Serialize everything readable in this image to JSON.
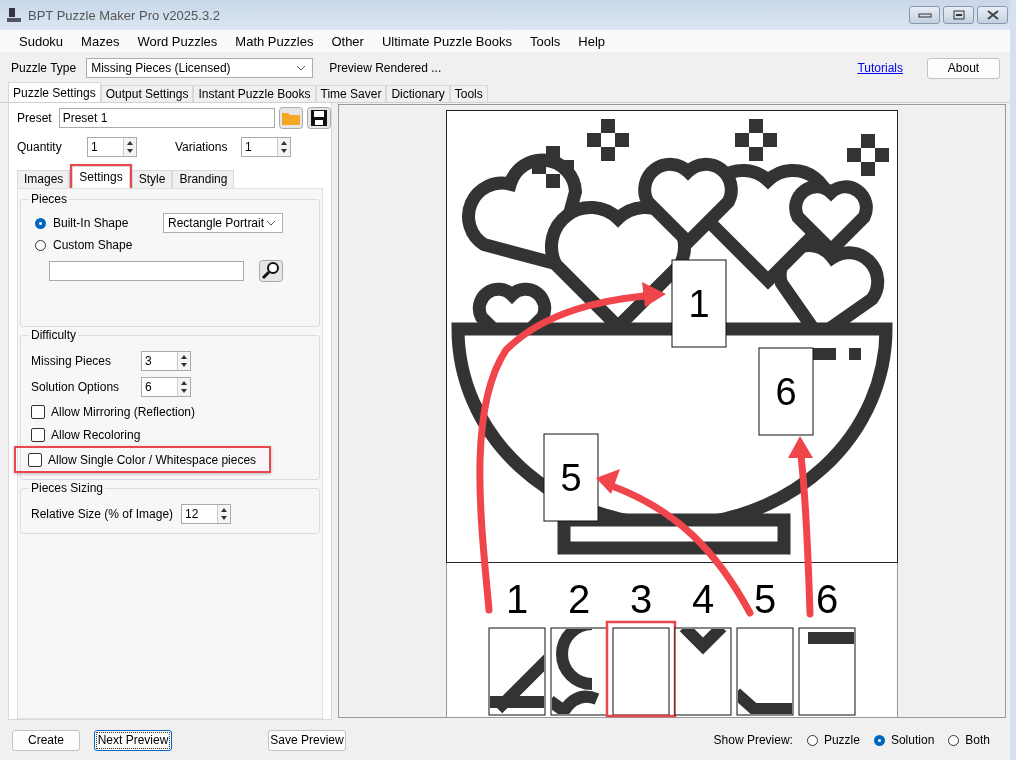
{
  "window": {
    "title": "BPT Puzzle Maker Pro v2025.3.2"
  },
  "menu": [
    "Sudoku",
    "Mazes",
    "Word Puzzles",
    "Math Puzzles",
    "Other",
    "Ultimate Puzzle Books",
    "Tools",
    "Help"
  ],
  "puzzle_type": {
    "label": "Puzzle Type",
    "value": "Missing Pieces (Licensed)"
  },
  "status": "Preview Rendered ...",
  "tutorials_link": "Tutorials",
  "about_button": "About",
  "main_tabs": [
    {
      "label": "Puzzle Settings",
      "selected": true
    },
    {
      "label": "Output Settings",
      "selected": false
    },
    {
      "label": "Instant Puzzle Books",
      "selected": false
    },
    {
      "label": "Time Saver",
      "selected": false
    },
    {
      "label": "Dictionary",
      "selected": false
    },
    {
      "label": "Tools",
      "selected": false
    }
  ],
  "preset": {
    "label": "Preset",
    "value": "Preset 1"
  },
  "quantity": {
    "label": "Quantity",
    "value": "1"
  },
  "variations": {
    "label": "Variations",
    "value": "1"
  },
  "sub_tabs": [
    {
      "label": "Images",
      "selected": false,
      "highlighted": false
    },
    {
      "label": "Settings",
      "selected": true,
      "highlighted": true
    },
    {
      "label": "Style",
      "selected": false,
      "highlighted": false
    },
    {
      "label": "Branding",
      "selected": false,
      "highlighted": false
    }
  ],
  "pieces": {
    "title": "Pieces",
    "options": [
      {
        "label": "Built-In Shape",
        "selected": true
      },
      {
        "label": "Custom Shape",
        "selected": false
      }
    ],
    "shape": "Rectangle Portrait"
  },
  "difficulty": {
    "title": "Difficulty",
    "spinners": [
      {
        "label": "Missing Pieces",
        "value": "3"
      },
      {
        "label": "Solution Options",
        "value": "6"
      }
    ],
    "checks": [
      {
        "label": "Allow Mirroring (Reflection)",
        "checked": false,
        "highlighted": false
      },
      {
        "label": "Allow Recoloring",
        "checked": false,
        "highlighted": false
      },
      {
        "label": "Allow  Single Color / Whitespace pieces",
        "checked": false,
        "highlighted": true
      }
    ]
  },
  "sizing": {
    "title": "Pieces Sizing",
    "label": "Relative Size (% of Image)",
    "value": "12"
  },
  "preview": {
    "placed": [
      {
        "label": "1"
      },
      {
        "label": "6"
      },
      {
        "label": "5"
      }
    ],
    "options": [
      {
        "label": "1",
        "highlighted": false
      },
      {
        "label": "2",
        "highlighted": false
      },
      {
        "label": "3",
        "highlighted": true
      },
      {
        "label": "4",
        "highlighted": false
      },
      {
        "label": "5",
        "highlighted": false
      },
      {
        "label": "6",
        "highlighted": false
      }
    ]
  },
  "bottom": {
    "buttons": [
      "Create",
      "Next Preview",
      "Save Preview"
    ],
    "show_label": "Show Preview:",
    "modes": [
      {
        "label": "Puzzle",
        "selected": false
      },
      {
        "label": "Solution",
        "selected": true
      },
      {
        "label": "Both",
        "selected": false
      }
    ]
  }
}
